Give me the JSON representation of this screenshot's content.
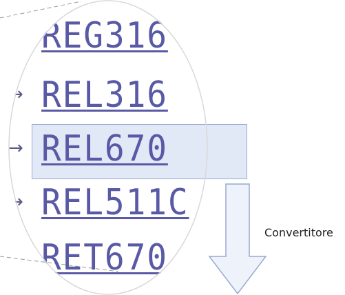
{
  "models": [
    {
      "label": "REG316"
    },
    {
      "label": "REL316"
    },
    {
      "label": "REL670"
    },
    {
      "label": "REL511C"
    },
    {
      "label": "RET670"
    }
  ],
  "selected_model": "REL670",
  "arrow_label": "Convertitore",
  "bullet_glyph": "→",
  "colors": {
    "link": "#5959a6",
    "highlight_fill": "#c8d7f0",
    "highlight_border": "#9aa8d0",
    "arrow_fill": "#eef3fb",
    "arrow_stroke": "#9aa8d0",
    "lens_border": "#d8d8d8",
    "zoom_line": "#999999"
  }
}
